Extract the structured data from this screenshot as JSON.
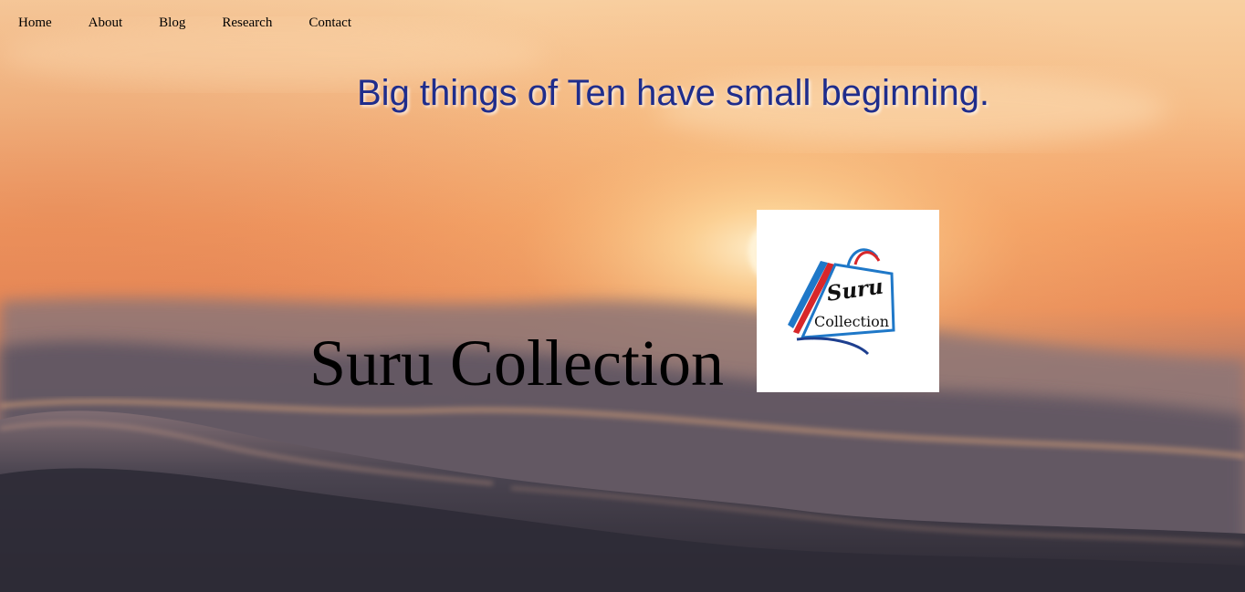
{
  "nav": {
    "items": [
      {
        "label": "Home"
      },
      {
        "label": "About"
      },
      {
        "label": "Blog"
      },
      {
        "label": "Research"
      },
      {
        "label": "Contact"
      }
    ]
  },
  "hero": {
    "tagline": "Big things of Ten have small beginning.",
    "brand_title": "Suru Collection",
    "background": "sunset-over-ocean-waves"
  },
  "logo": {
    "line1": "Suru",
    "line2": "Collection",
    "icon": "shopping-bag-icon",
    "colors": {
      "blue": "#1f78c8",
      "red": "#d8272a",
      "dark_blue": "#1e3f8f"
    }
  },
  "colors": {
    "tagline": "#1f2d8c",
    "title": "#000000",
    "nav_text": "#000000"
  }
}
